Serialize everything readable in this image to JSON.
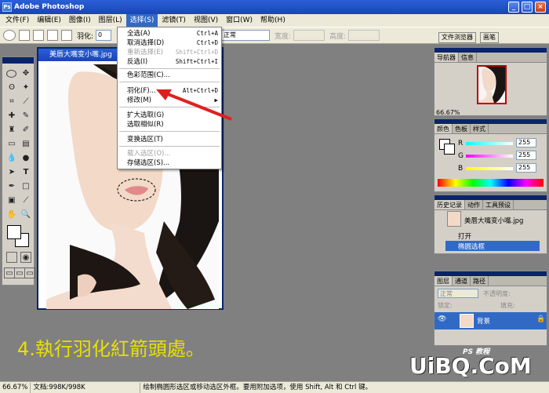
{
  "window": {
    "title": "Adobe Photoshop",
    "min": "_",
    "max": "□",
    "close": "×"
  },
  "menubar": [
    "文件(F)",
    "编辑(E)",
    "图像(I)",
    "图层(L)",
    "选择(S)",
    "滤镜(T)",
    "视图(V)",
    "窗口(W)",
    "帮助(H)"
  ],
  "options": {
    "feather_label": "羽化:",
    "feather_value": "0",
    "mode_value": "正常",
    "width_label": "宽度:",
    "height_label": "高度:",
    "file_browser": "文件浏览器",
    "brushes": "画笔"
  },
  "document": {
    "title": "美唇大嘴变小嘴.jpg"
  },
  "select_menu": {
    "items": [
      {
        "label": "全选(A)",
        "shortcut": "Ctrl+A",
        "disabled": false
      },
      {
        "label": "取消选择(D)",
        "shortcut": "Ctrl+D",
        "disabled": false
      },
      {
        "label": "重新选择(E)",
        "shortcut": "Shift+Ctrl+D",
        "disabled": true
      },
      {
        "label": "反选(I)",
        "shortcut": "Shift+Ctrl+I",
        "disabled": false
      },
      {
        "label": "色彩范围(C)...",
        "shortcut": "",
        "disabled": false
      },
      {
        "label": "羽化(F)...",
        "shortcut": "Alt+Ctrl+D",
        "disabled": false
      },
      {
        "label": "修改(M)",
        "shortcut": "▶",
        "disabled": false
      },
      {
        "label": "扩大选取(G)",
        "shortcut": "",
        "disabled": false
      },
      {
        "label": "选取相似(R)",
        "shortcut": "",
        "disabled": false
      },
      {
        "label": "变换选区(T)",
        "shortcut": "",
        "disabled": false
      },
      {
        "label": "载入选区(O)...",
        "shortcut": "",
        "disabled": true
      },
      {
        "label": "存储选区(S)...",
        "shortcut": "",
        "disabled": false
      }
    ]
  },
  "navigator": {
    "tabs": [
      "导航器",
      "信息"
    ],
    "zoom": "66.67%"
  },
  "color": {
    "tabs": [
      "颜色",
      "色板",
      "样式"
    ],
    "r_label": "R",
    "g_label": "G",
    "b_label": "B",
    "r": "255",
    "g": "255",
    "b": "255"
  },
  "history": {
    "tabs": [
      "历史记录",
      "动作",
      "工具预设"
    ],
    "snapshot": "美唇大嘴变小嘴.jpg",
    "steps": [
      "打开",
      "椭圆选框"
    ]
  },
  "layers": {
    "tabs": [
      "图层",
      "通道",
      "路径"
    ],
    "blend": "正常",
    "opacity_label": "不透明度:",
    "lock_label": "锁定:",
    "fill_label": "填充:",
    "layer_name": "背景"
  },
  "caption": "4.執行羽化紅箭頭處。",
  "watermark": "UiBQ.CoM",
  "watermark_sub": "PS 教程",
  "status": {
    "zoom": "66.67%",
    "doc": "文档:998K/998K",
    "hint": "绘制椭圆形选区或移动选区外框。要用附加选项，使用 Shift, Alt 和 Ctrl 键。"
  },
  "colors": {
    "titlebar": "#1a44b8",
    "highlight": "#316ac5",
    "caption": "#e8e000",
    "arrow": "#e02020"
  }
}
